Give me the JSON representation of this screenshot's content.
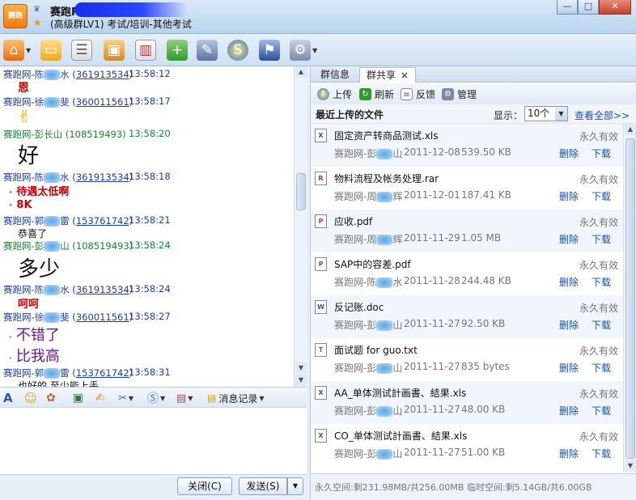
{
  "window": {
    "title": "赛跑R",
    "subtitle": "(高级群LV1) 考试/培训-其他考试",
    "app_icon_text": "赛跑",
    "controls": {
      "minimize": "—",
      "maximize": "□",
      "close": "✕"
    }
  },
  "toolbar": {
    "icons": [
      "home-icon",
      "folder-icon",
      "notes-icon",
      "album-icon",
      "chart-icon",
      "add-app-icon",
      "tools-icon",
      "s-app-icon",
      "settings-hat-icon",
      "gear-icon"
    ]
  },
  "chat": {
    "messages": [
      {
        "name": "赛跑网-陈",
        "name_suffix": "水",
        "qq": "361913534",
        "time": "13:58:12",
        "color": "#1b3fa6",
        "body": "恩",
        "body_style": "red-bold"
      },
      {
        "name": "赛跑网-徐",
        "name_suffix": "斐",
        "qq": "360011561",
        "time": "13:58:17",
        "color": "#1b3fa6",
        "body": "✌",
        "body_style": "emoji"
      },
      {
        "name": "赛跑网-彭长山",
        "name_suffix": "",
        "qq": "108519493",
        "time": "13:58:20",
        "color": "#128a2e",
        "body": "好",
        "body_style": "big-black"
      },
      {
        "name": "赛跑网-陈",
        "name_suffix": "水",
        "qq": "361913534",
        "time": "13:58:18",
        "color": "#1b3fa6",
        "body": "待遇太低啊",
        "body2": "8K",
        "body_style": "red-list"
      },
      {
        "name": "赛跑网-郭",
        "name_suffix": "雷",
        "qq": "153761742",
        "time": "13:58:21",
        "color": "#1b3fa6",
        "body": "恭喜了",
        "body_style": "plain"
      },
      {
        "name": "赛跑网-彭",
        "name_suffix": "山",
        "qq": "108519493",
        "time": "13:58:24",
        "color": "#128a2e",
        "body": "多少",
        "body_style": "big-black"
      },
      {
        "name": "赛跑网-陈",
        "name_suffix": "水",
        "qq": "361913534",
        "time": "13:58:24",
        "color": "#1b3fa6",
        "body": "呵呵",
        "body_style": "red-bold"
      },
      {
        "name": "赛跑网-徐",
        "name_suffix": "斐",
        "qq": "360011561",
        "time": "13:58:27",
        "color": "#1b3fa6",
        "body": "不错了",
        "body2": "比我高",
        "body_style": "purple-list"
      },
      {
        "name": "赛跑网-郭",
        "name_suffix": "雷",
        "qq": "153761742",
        "time": "13:58:31",
        "color": "#1b3fa6",
        "body": "也好的 至少能上手",
        "body_style": "plain"
      }
    ]
  },
  "input_toolbar": {
    "history_label": "消息记录",
    "icons": [
      "font-icon",
      "smiley-icon",
      "magic-face-icon",
      "image-icon",
      "handwrite-icon",
      "screenshot-icon",
      "s-app-icon",
      "more-icon"
    ]
  },
  "bottom_buttons": {
    "close_label": "关闭(C)",
    "send_label": "发送(S)"
  },
  "right_panel": {
    "tabs": [
      "群信息",
      "群共享"
    ],
    "active_tab_close": "×",
    "actions": {
      "upload": "上传",
      "refresh": "刷新",
      "feedback": "反馈",
      "manage": "管理"
    },
    "recent_title": "最近上传的文件",
    "display_label": "显示：",
    "display_value": "10个",
    "view_all": "查看全部>>",
    "files": [
      {
        "name": "固定资产转商品测试.xls",
        "icon": "xls",
        "expiry": "永久有效",
        "uploader": "赛跑网-彭",
        "uploader_suffix": "山",
        "date": "2011-12-08",
        "size": "539.50 KB",
        "delete": "删除",
        "download": "下载"
      },
      {
        "name": "物料流程及帐务处理.rar",
        "icon": "rar",
        "expiry": "永久有效",
        "uploader": "赛跑网-周",
        "uploader_suffix": "辉",
        "date": "2011-12-01",
        "size": "187.41 KB",
        "delete": "删除",
        "download": "下载"
      },
      {
        "name": "应收.pdf",
        "icon": "pdf",
        "expiry": "永久有效",
        "uploader": "赛跑网-周",
        "uploader_suffix": "辉",
        "date": "2011-11-29",
        "size": "1.05 MB",
        "delete": "删除",
        "download": "下载"
      },
      {
        "name": "SAP中的容差.pdf",
        "icon": "pdf",
        "expiry": "永久有效",
        "uploader": "赛跑网-陈",
        "uploader_suffix": "水",
        "date": "2011-11-28",
        "size": "244.48 KB",
        "delete": "删除",
        "download": "下载"
      },
      {
        "name": "反记账.doc",
        "icon": "doc",
        "expiry": "永久有效",
        "uploader": "赛跑网-彭",
        "uploader_suffix": "山",
        "date": "2011-11-27",
        "size": "92.50 KB",
        "delete": "删除",
        "download": "下载"
      },
      {
        "name": "面试题 for guo.txt",
        "icon": "txt",
        "expiry": "永久有效",
        "uploader": "赛跑网-彭",
        "uploader_suffix": "山",
        "date": "2011-11-27",
        "size": "835 bytes",
        "delete": "删除",
        "download": "下载"
      },
      {
        "name": "AA_单体测试計画書、結果.xls",
        "icon": "xls",
        "expiry": "永久有效",
        "uploader": "赛跑网-彭",
        "uploader_suffix": "山",
        "date": "2011-11-27",
        "size": "48.00 KB",
        "delete": "删除",
        "download": "下载"
      },
      {
        "name": "CO_单体测试計画書、結果.xls",
        "icon": "xls",
        "expiry": "永久有效",
        "uploader": "赛跑网-彭",
        "uploader_suffix": "山",
        "date": "2011-11-27",
        "size": "51.00 KB",
        "delete": "删除",
        "download": "下载"
      }
    ],
    "status": "永久空间:剩231.98MB/共256.00MB 临时空间:剩5.14GB/共6.00GB"
  }
}
